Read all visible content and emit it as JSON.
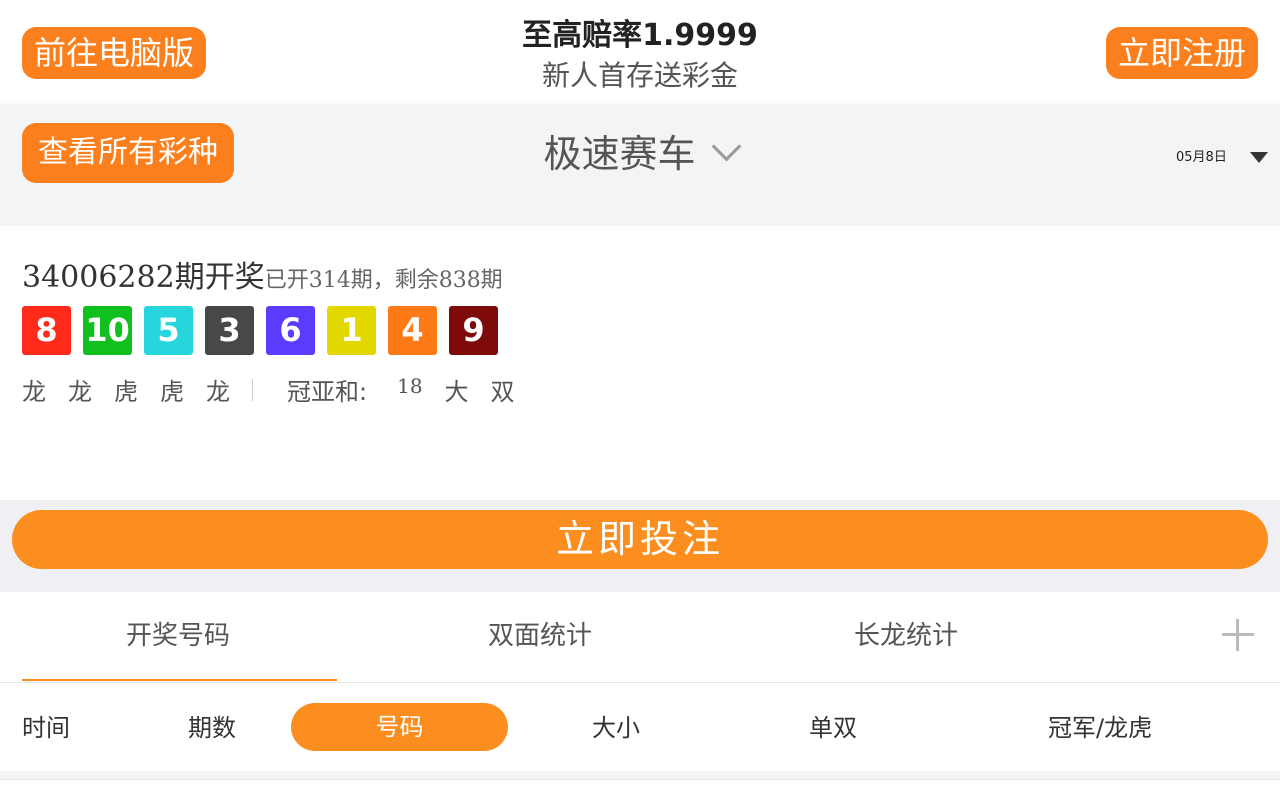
{
  "header": {
    "pc_button": "前往电脑版",
    "title": "至高赔率1.9999",
    "subtitle": "新人首存送彩金",
    "register_button": "立即注册"
  },
  "game_bar": {
    "all_button": "查看所有彩种",
    "game_name": "极速赛车",
    "date": "05月8日"
  },
  "result": {
    "issue_main": "34006282期开奖",
    "issue_extra": "已开314期，剩余838期",
    "balls": [
      {
        "num": "8",
        "color": "#ff2a1a"
      },
      {
        "num": "10",
        "color": "#10c01e"
      },
      {
        "num": "5",
        "color": "#27d6dc"
      },
      {
        "num": "3",
        "color": "#484848"
      },
      {
        "num": "6",
        "color": "#5a3cff"
      },
      {
        "num": "1",
        "color": "#e2d800"
      },
      {
        "num": "4",
        "color": "#fd7a16"
      },
      {
        "num": "9",
        "color": "#7e0a0a"
      }
    ],
    "dragon_tiger": [
      "龙",
      "龙",
      "虎",
      "虎",
      "龙"
    ],
    "sum_label": "冠亚和:",
    "sum_value": "18",
    "sum_size": "大",
    "sum_parity": "双"
  },
  "bet_button": "立即投注",
  "tabs": {
    "items": [
      "开奖号码",
      "双面统计",
      "长龙统计"
    ],
    "active": "开奖号码",
    "accent": "#fb8e1e"
  },
  "sub_filters": {
    "time": "时间",
    "issue": "期数",
    "number": "号码",
    "size": "大小",
    "parity": "单双",
    "champion": "冠军/龙虎"
  }
}
